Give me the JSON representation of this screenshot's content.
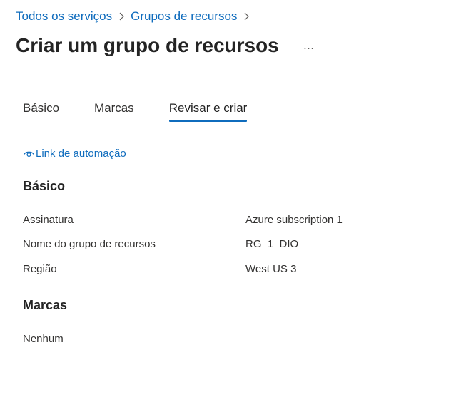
{
  "breadcrumb": {
    "items": [
      {
        "label": "Todos os serviços"
      },
      {
        "label": "Grupos de recursos"
      }
    ]
  },
  "page": {
    "title": "Criar um grupo de recursos",
    "more_label": "…"
  },
  "tabs": [
    {
      "label": "Básico",
      "active": false
    },
    {
      "label": "Marcas",
      "active": false
    },
    {
      "label": "Revisar e criar",
      "active": true
    }
  ],
  "automation": {
    "icon": "eye-icon",
    "label": "Link de automação"
  },
  "sections": {
    "basics": {
      "title": "Básico",
      "rows": [
        {
          "label": "Assinatura",
          "value": "Azure subscription 1"
        },
        {
          "label": "Nome do grupo de recursos",
          "value": "RG_1_DIO"
        },
        {
          "label": "Região",
          "value": "West US 3"
        }
      ]
    },
    "tags": {
      "title": "Marcas",
      "empty_text": "Nenhum"
    }
  },
  "colors": {
    "accent": "#0f6cbd",
    "text": "#323130",
    "heading": "#242424"
  }
}
